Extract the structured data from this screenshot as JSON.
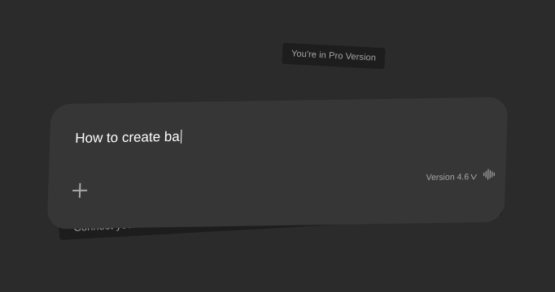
{
  "badge": {
    "text": "You're in Pro Version"
  },
  "prompt": {
    "value": "How to create ba"
  },
  "composer": {
    "version_label": "Version 4.6",
    "version_chevron": "V"
  },
  "footer": {
    "text": "Connect your device to artificial intelligence",
    "chevron": "›"
  },
  "icons": {
    "add": "plus-icon",
    "voice": "voice-waveform-icon",
    "footer_arrow": "chevron-right-icon"
  },
  "colors": {
    "background": "#2b2b2b",
    "card": "#363636",
    "panel": "#1d1d1d",
    "text_primary": "#ffffff",
    "text_muted": "#a8a8a8"
  }
}
